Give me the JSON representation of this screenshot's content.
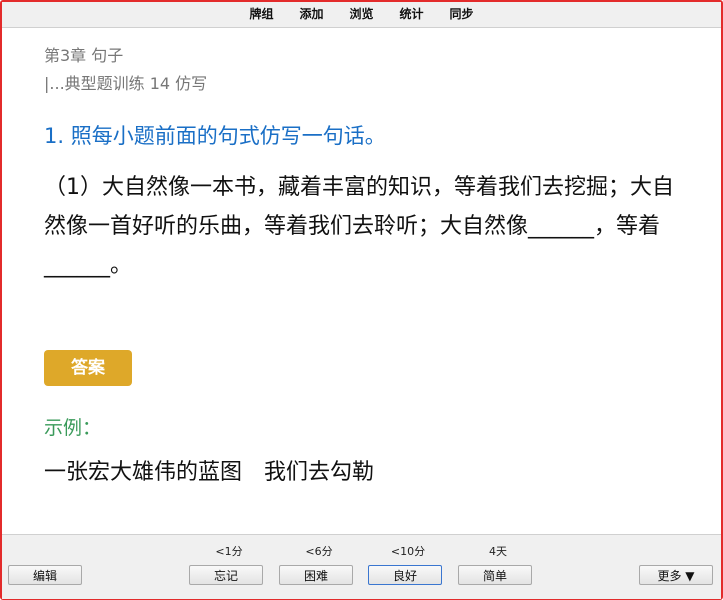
{
  "menubar": {
    "items": [
      "牌组",
      "添加",
      "浏览",
      "统计",
      "同步"
    ]
  },
  "card": {
    "chapter": "第3章 句子",
    "section": "|...典型题训练 14 仿写",
    "question_title": "1. 照每小题前面的句式仿写一句话。",
    "question_body": "（1）大自然像一本书，藏着丰富的知识，等着我们去挖掘；大自然像一首好听的乐曲，等着我们去聆听；大自然像______，等着______。",
    "answer_label": "答案",
    "example_label": "示例：",
    "example_text": "一张宏大雄伟的蓝图　我们去勾勒"
  },
  "bottombar": {
    "edit_label": "编辑",
    "more_label": "更多 ▼",
    "times": [
      "<1分",
      "<6分",
      "<10分",
      "4天"
    ],
    "buttons": [
      "忘记",
      "困难",
      "良好",
      "简单"
    ]
  },
  "colors": {
    "frame": "#e32b2b",
    "question_title": "#1a6fc6",
    "answer_badge": "#dea829",
    "example_label": "#3a9a5a"
  }
}
